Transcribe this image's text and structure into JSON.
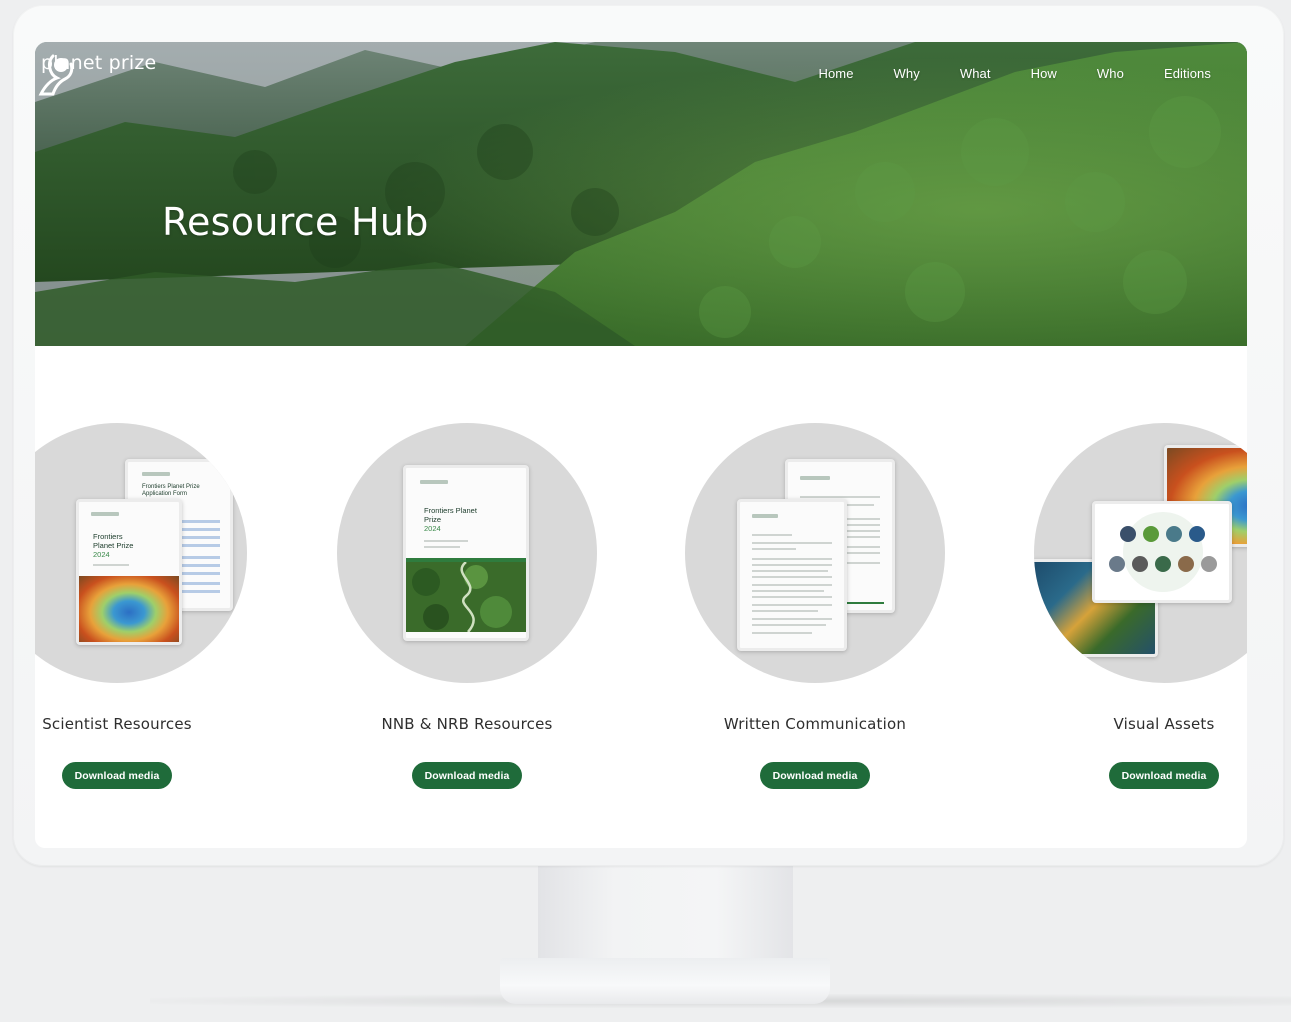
{
  "brand": {
    "name": "planet prize"
  },
  "nav": {
    "items": [
      {
        "label": "Home"
      },
      {
        "label": "Why"
      },
      {
        "label": "What"
      },
      {
        "label": "How"
      },
      {
        "label": "Who"
      },
      {
        "label": "Editions"
      }
    ]
  },
  "hero": {
    "title": "Resource Hub"
  },
  "resources": [
    {
      "title": "Scientist Resources",
      "button": "Download media",
      "thumb": {
        "back_title": "Frontiers Planet Prize Application Form",
        "front_title": "Frontiers Planet Prize",
        "front_year": "2024"
      }
    },
    {
      "title": "NNB & NRB Resources",
      "button": "Download media",
      "thumb": {
        "front_title": "Frontiers Planet Prize",
        "front_year": "2024"
      }
    },
    {
      "title": "Written Communication",
      "button": "Download media"
    },
    {
      "title": "Visual Assets",
      "button": "Download media"
    }
  ],
  "colors": {
    "button": "#1f6b3a",
    "circle": "#d9d9d9",
    "accent_green": "#3a8a4a"
  }
}
